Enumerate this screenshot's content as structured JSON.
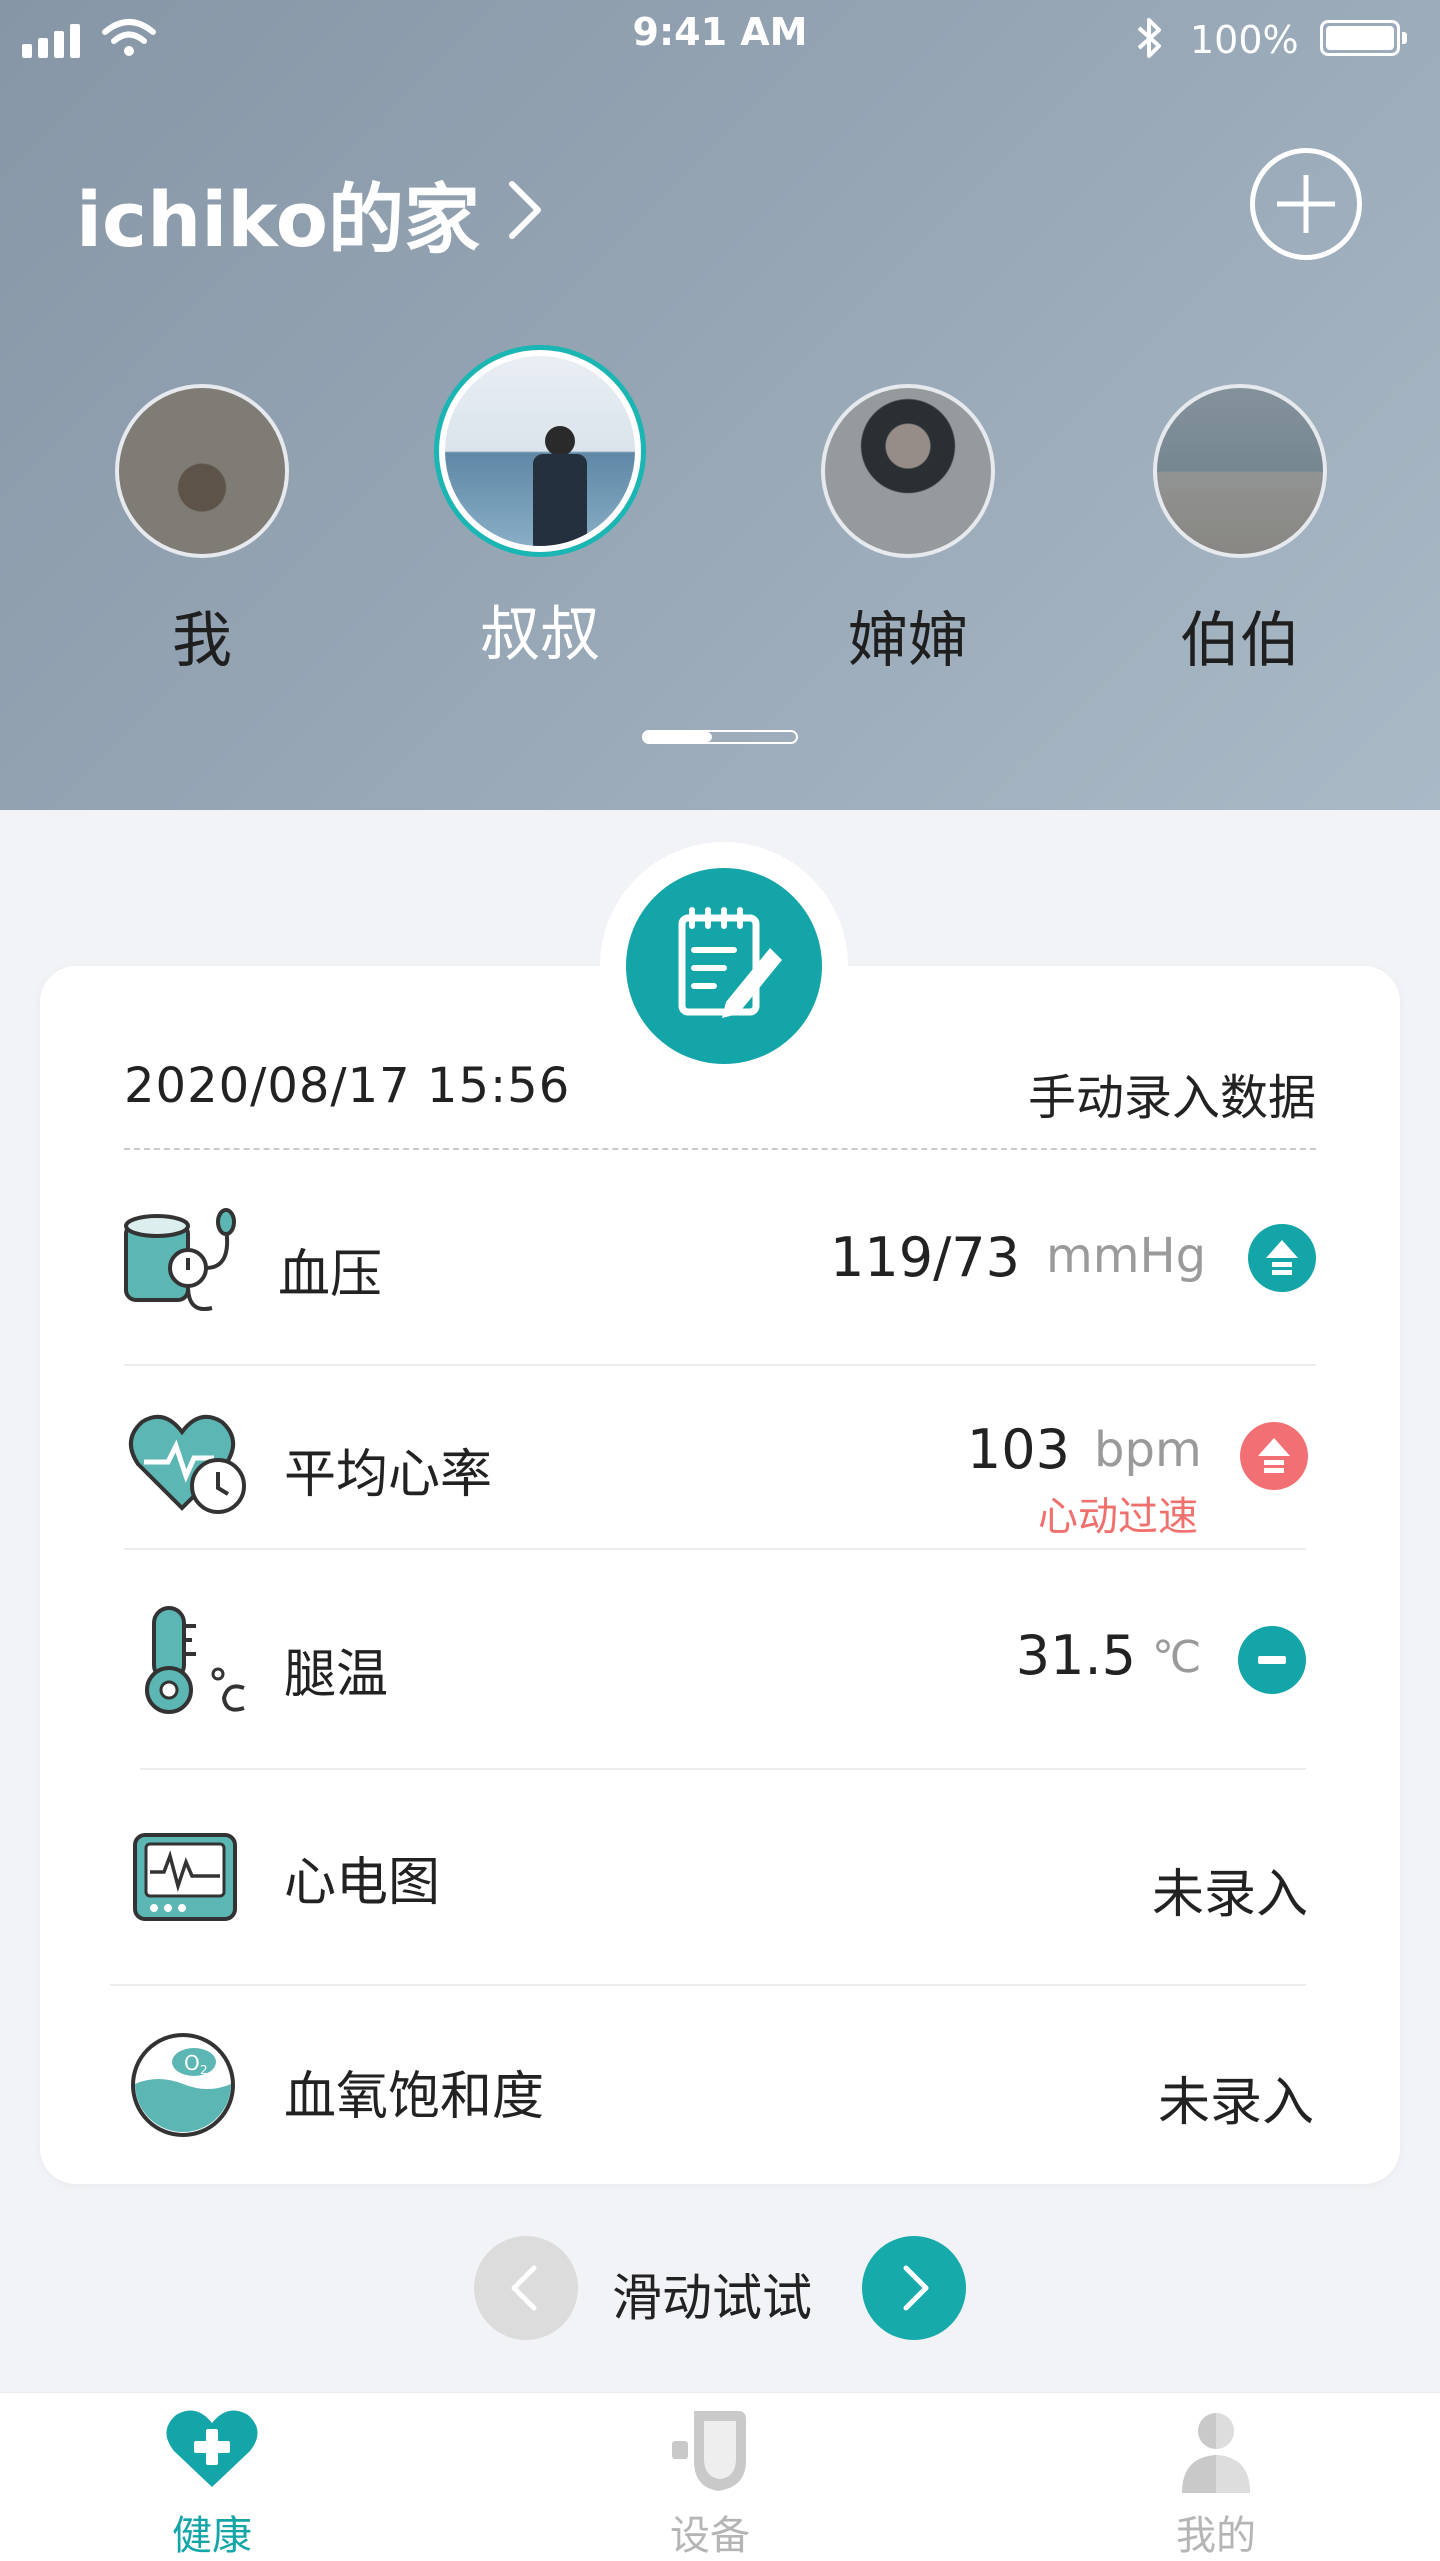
{
  "status_bar": {
    "time": "9:41 AM",
    "battery": "100%"
  },
  "header": {
    "home_title": "ichiko的家",
    "members": [
      {
        "name": "我"
      },
      {
        "name": "叔叔"
      },
      {
        "name": "婶婶"
      },
      {
        "name": "伯伯"
      }
    ]
  },
  "card": {
    "datetime": "2020/08/17  15:56",
    "source": "手动录入数据",
    "rows": [
      {
        "label": "血压",
        "value": "119/73",
        "unit": "mmHg",
        "trend": "up",
        "trend_color": "#13a5a7"
      },
      {
        "label": "平均心率",
        "value": "103",
        "unit": "bpm",
        "warning": "心动过速",
        "trend": "up",
        "trend_color": "#f27074"
      },
      {
        "label": "腿温",
        "value": "31.5",
        "unit": "℃",
        "trend": "flat",
        "trend_color": "#13a5a7"
      },
      {
        "label": "心电图",
        "value": "未录入"
      },
      {
        "label": "血氧饱和度",
        "value": "未录入"
      }
    ]
  },
  "swipe": {
    "label": "滑动试试"
  },
  "tabbar": {
    "tabs": [
      {
        "label": "健康",
        "icon": "heart-plus-icon",
        "active": true
      },
      {
        "label": "设备",
        "icon": "device-icon",
        "active": false
      },
      {
        "label": "我的",
        "icon": "user-icon",
        "active": false
      }
    ]
  },
  "colors": {
    "accent": "#13a5a7",
    "warning": "#f27074"
  }
}
